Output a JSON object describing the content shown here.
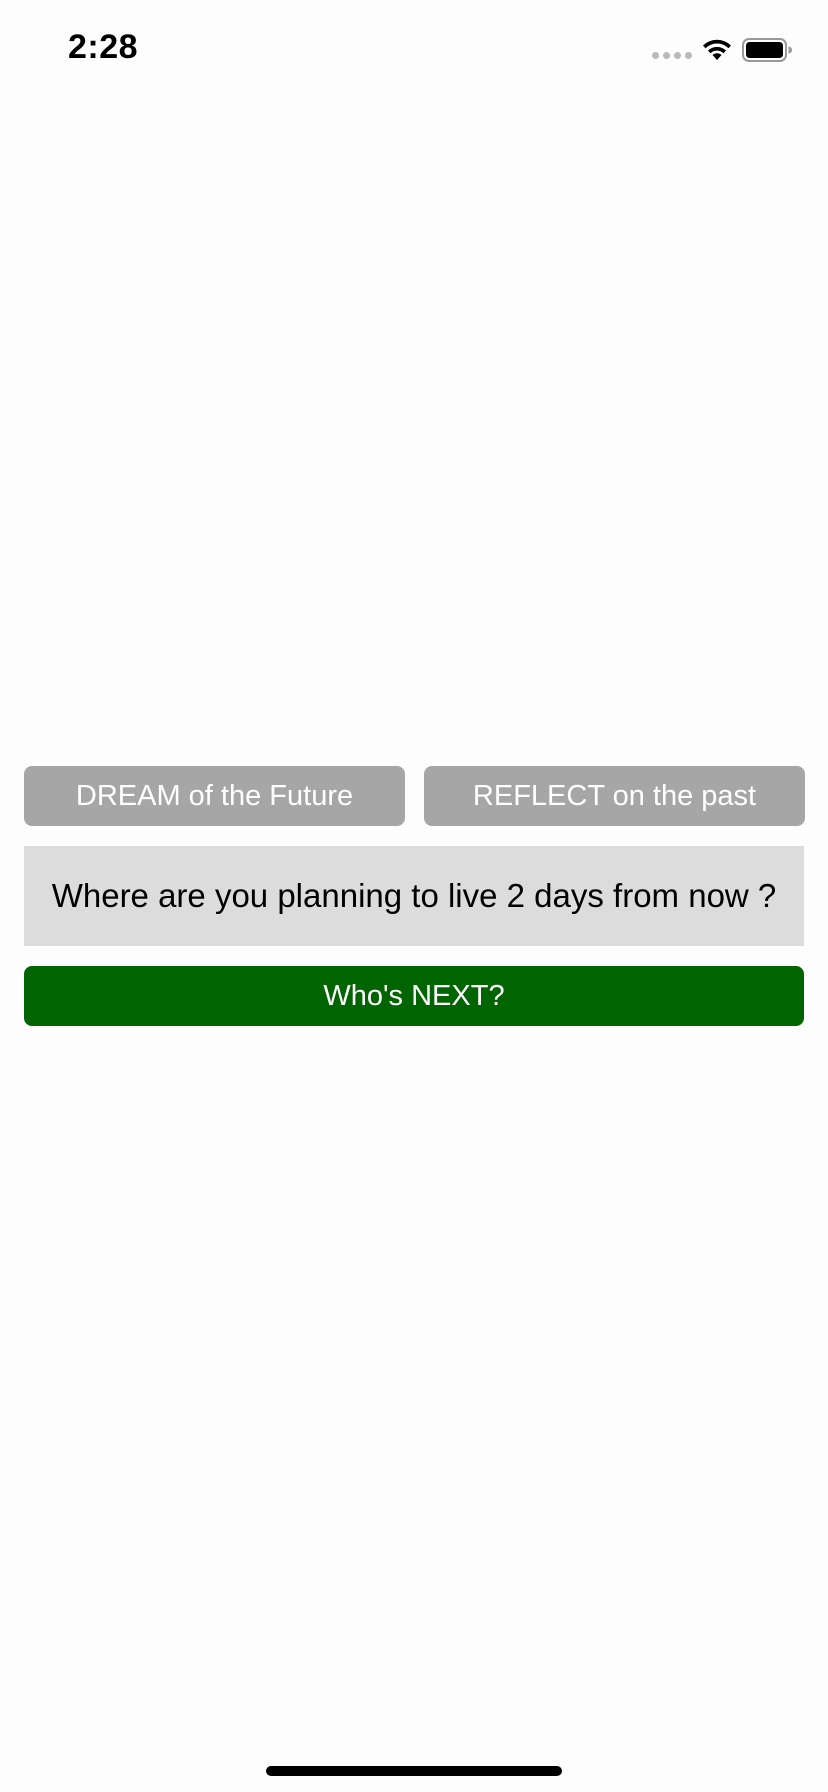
{
  "status_bar": {
    "time": "2:28",
    "icons": [
      "signal-dots-icon",
      "wifi-icon",
      "battery-icon"
    ]
  },
  "buttons": {
    "dream_label": "DREAM of the Future",
    "reflect_label": "REFLECT on the past",
    "next_label": "Who's NEXT?"
  },
  "question": {
    "text": "Where are you planning to live 2 days from now ?"
  },
  "colors": {
    "mode_button_bg": "#a6a6a6",
    "question_bg": "#dcdcdc",
    "next_button_bg": "#006400",
    "background": "#fdfdfd"
  }
}
